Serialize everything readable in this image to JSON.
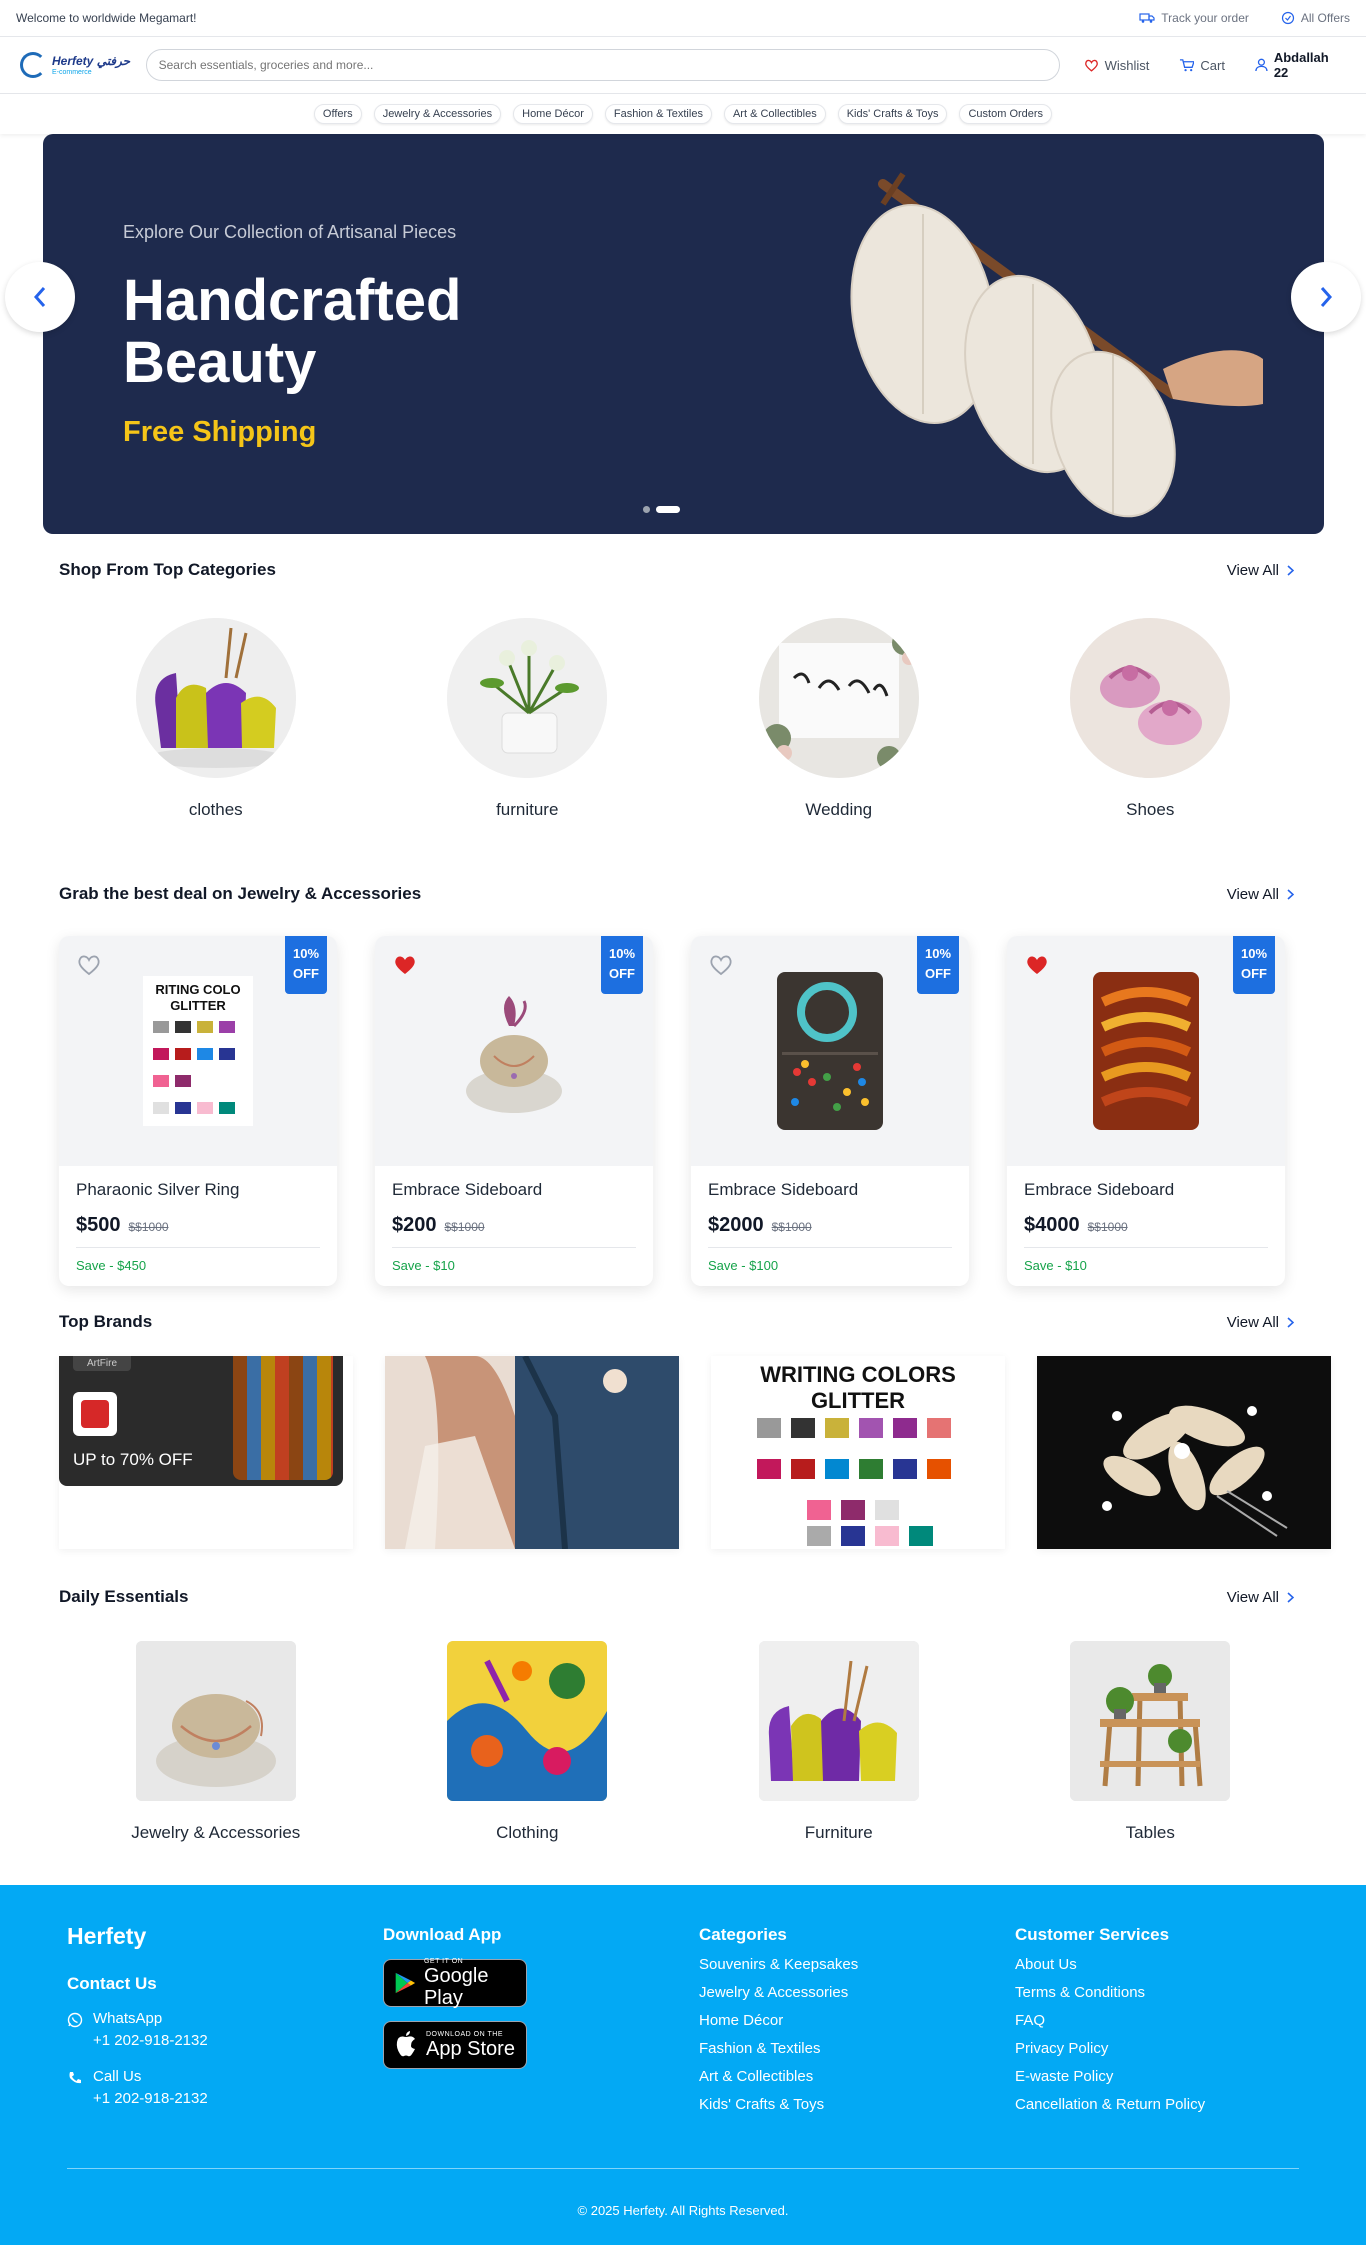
{
  "topbar": {
    "welcome": "Welcome to worldwide Megamart!",
    "track": "Track your order",
    "offers": "All Offers"
  },
  "header": {
    "logo_name": "Herfety حرفتي",
    "logo_sub": "E-commerce",
    "search_placeholder": "Search essentials, groceries and more...",
    "wishlist": "Wishlist",
    "cart": "Cart",
    "user": "Abdallah 22"
  },
  "nav": {
    "items": [
      "Offers",
      "Jewelry & Accessories",
      "Home Décor",
      "Fashion & Textiles",
      "Art & Collectibles",
      "Kids' Crafts & Toys",
      "Custom Orders"
    ]
  },
  "hero": {
    "subtitle": "Explore Our Collection of Artisanal Pieces",
    "title": "Handcrafted Beauty",
    "promo": "Free Shipping",
    "slide": 2,
    "slides": 2
  },
  "top_categories": {
    "title": "Shop From Top Categories",
    "view_all": "View All",
    "items": [
      {
        "label": "clothes",
        "image": "purple-yellow-vases"
      },
      {
        "label": "furniture",
        "image": "flower-pot"
      },
      {
        "label": "Wedding",
        "image": "im-a-catch-sign"
      },
      {
        "label": "Shoes",
        "image": "pink-baby-shoes"
      }
    ]
  },
  "deals": {
    "title": "Grab the best deal on Jewelry & Accessories",
    "view_all": "View All",
    "items": [
      {
        "badge_pct": "10%",
        "badge_off": "OFF",
        "favorited": false,
        "name": "Pharaonic Silver Ring",
        "price": "$500",
        "old_price": "$$1000",
        "save": "Save - $450",
        "image": "writing-color-glitter"
      },
      {
        "badge_pct": "10%",
        "badge_off": "OFF",
        "favorited": true,
        "name": "Embrace Sideboard",
        "price": "$200",
        "old_price": "$$1000",
        "save": "Save - $10",
        "image": "stone-jewelry"
      },
      {
        "badge_pct": "10%",
        "badge_off": "OFF",
        "favorited": false,
        "name": "Embrace Sideboard",
        "price": "$2000",
        "old_price": "$$1000",
        "save": "Save - $100",
        "image": "bead-tray"
      },
      {
        "badge_pct": "10%",
        "badge_off": "OFF",
        "favorited": true,
        "name": "Embrace Sideboard",
        "price": "$4000",
        "old_price": "$$1000",
        "save": "Save - $10",
        "image": "bangles"
      }
    ]
  },
  "brands": {
    "title": "Top Brands",
    "view_all": "View All",
    "items": [
      {
        "type": "promo",
        "tag": "ArtFire",
        "text": "UP to 70% OFF"
      },
      {
        "type": "image",
        "image": "wedding-couple"
      },
      {
        "type": "image",
        "image": "writing-colors-glitter-chart",
        "title": "WRITING COLORS GLITTER"
      },
      {
        "type": "image",
        "image": "pearl-hair-comb"
      }
    ]
  },
  "essentials": {
    "title": "Daily Essentials",
    "view_all": "View All",
    "items": [
      {
        "label": "Jewelry & Accessories",
        "image": "stone-jewelry"
      },
      {
        "label": "Clothing",
        "image": "colorful-fabric"
      },
      {
        "label": "Furniture",
        "image": "purple-yellow-vases"
      },
      {
        "label": "Tables",
        "image": "wooden-plant-stand"
      }
    ]
  },
  "footer": {
    "brand": "Herfety",
    "contact_title": "Contact Us",
    "whatsapp_label": "WhatsApp",
    "whatsapp_number": "+1 202-918-2132",
    "call_label": "Call Us",
    "call_number": "+1 202-918-2132",
    "download_title": "Download App",
    "google_small": "GET IT ON",
    "google_big": "Google Play",
    "apple_small": "DOWNLOAD ON THE",
    "apple_big": "App Store",
    "categories_title": "Categories",
    "categories": [
      "Souvenirs & Keepsakes",
      "Jewelry & Accessories",
      "Home Décor",
      "Fashion & Textiles",
      "Art & Collectibles",
      "Kids' Crafts & Toys"
    ],
    "services_title": "Customer Services",
    "services": [
      "About Us",
      "Terms & Conditions",
      "FAQ",
      "Privacy Policy",
      "E-waste Policy",
      "Cancellation & Return Policy"
    ],
    "copyright": "© 2025 Herfety. All Rights Reserved."
  },
  "colors": {
    "hero_bg": "#1e2a4d",
    "accent_yellow": "#f5c518",
    "badge_blue": "#1d6fe0",
    "footer_bg": "#03a9f4",
    "save_green": "#16a34a",
    "heart_red": "#dc2626"
  }
}
